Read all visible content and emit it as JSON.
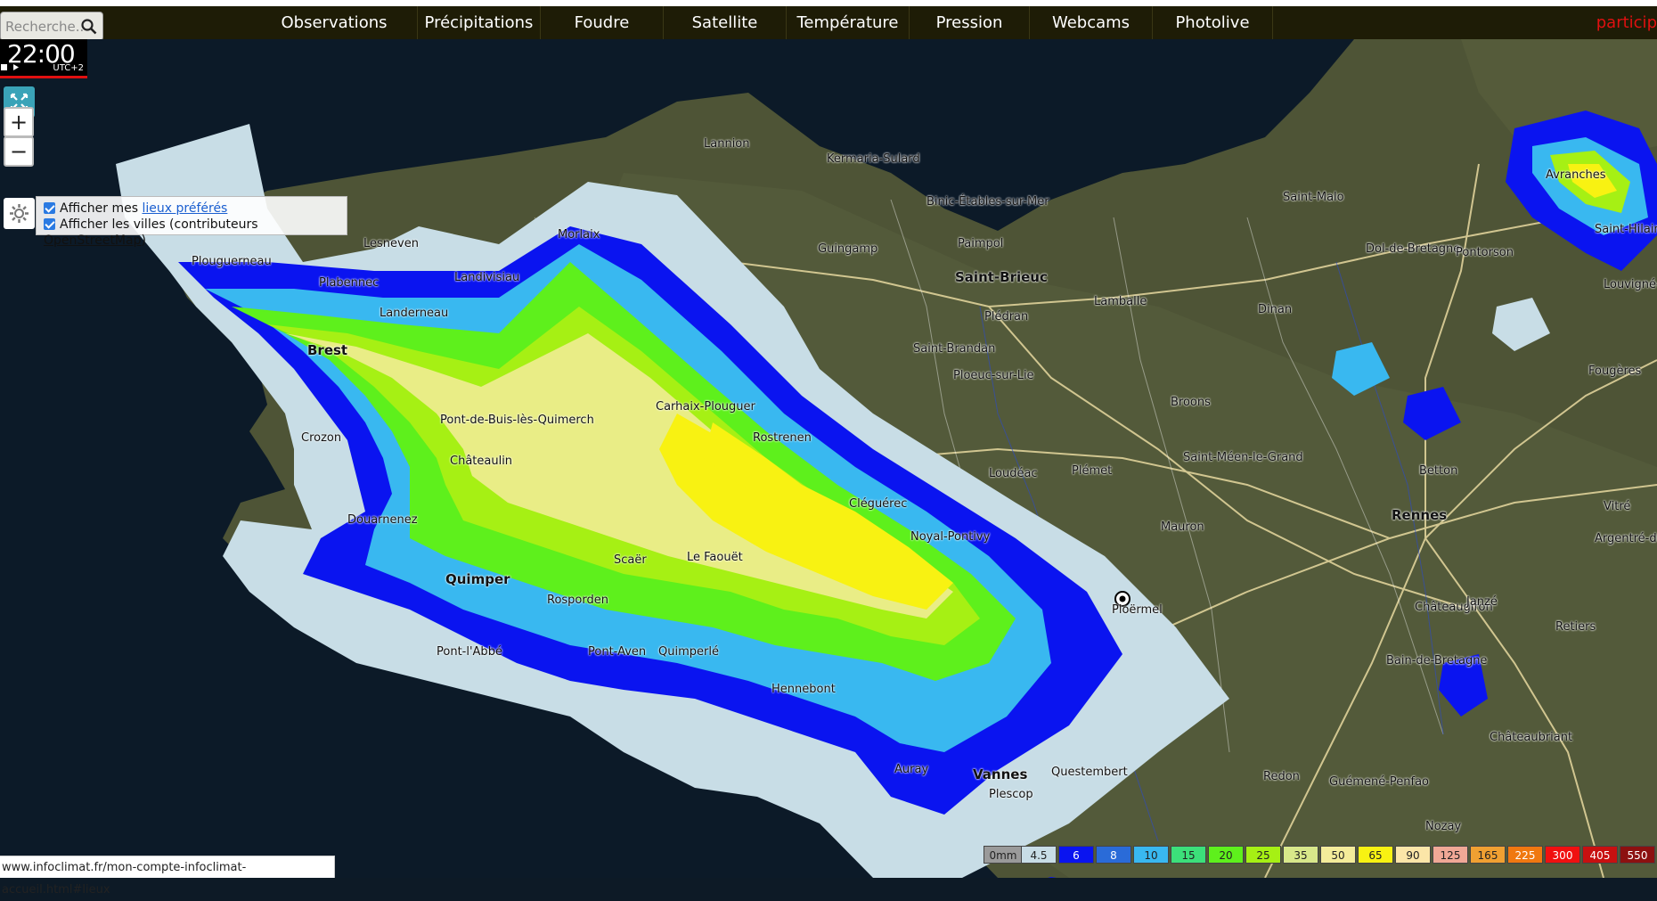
{
  "search": {
    "placeholder": "Recherche.."
  },
  "nav": {
    "items": [
      {
        "label": "Observations"
      },
      {
        "label": "Précipitations"
      },
      {
        "label": "Foudre"
      },
      {
        "label": "Satellite"
      },
      {
        "label": "Température"
      },
      {
        "label": "Pression"
      },
      {
        "label": "Webcams"
      },
      {
        "label": "Photolive"
      }
    ],
    "right_label": "particip"
  },
  "time": {
    "value": "22:00",
    "timezone": "UTC+2"
  },
  "layers": {
    "row1_prefix": "Afficher mes ",
    "row1_link": "lieux préférés",
    "row2_prefix": "Afficher les villes (contributeurs ",
    "row2_link": "OpenStreetMap",
    "row2_suffix": ")"
  },
  "status_url": "www.infoclimat.fr/mon-compte-infoclimat-accueil.html#lieux",
  "legend": [
    {
      "label": "0mm",
      "color": "#9a9a9a"
    },
    {
      "label": "4.5",
      "color": "#c8dde6"
    },
    {
      "label": "6",
      "color": "#0a14f0"
    },
    {
      "label": "8",
      "color": "#2a6bd8"
    },
    {
      "label": "10",
      "color": "#39b8f0"
    },
    {
      "label": "15",
      "color": "#3ce07a"
    },
    {
      "label": "20",
      "color": "#5ef01c"
    },
    {
      "label": "25",
      "color": "#a6f014"
    },
    {
      "label": "35",
      "color": "#d8e88a"
    },
    {
      "label": "50",
      "color": "#f4ec9a"
    },
    {
      "label": "65",
      "color": "#f8f212"
    },
    {
      "label": "90",
      "color": "#fbe6a8"
    },
    {
      "label": "125",
      "color": "#f0a896"
    },
    {
      "label": "165",
      "color": "#f0a032"
    },
    {
      "label": "225",
      "color": "#f07810"
    },
    {
      "label": "300",
      "color": "#f01010"
    },
    {
      "label": "405",
      "color": "#c81010"
    },
    {
      "label": "550",
      "color": "#8c1010"
    }
  ],
  "cities": [
    {
      "name": "Brest",
      "big": true
    },
    {
      "name": "Plouguerneau"
    },
    {
      "name": "Plabennec"
    },
    {
      "name": "Lesneven"
    },
    {
      "name": "Landerneau"
    },
    {
      "name": "Landivisiau"
    },
    {
      "name": "Morlaix"
    },
    {
      "name": "Lannion"
    },
    {
      "name": "Guingamp"
    },
    {
      "name": "Saint-Brieuc",
      "big": true
    },
    {
      "name": "Lamballe"
    },
    {
      "name": "Plédran"
    },
    {
      "name": "Saint-Brandan"
    },
    {
      "name": "Ploeuc-sur-Lie"
    },
    {
      "name": "Carhaix-Plouguer"
    },
    {
      "name": "Rostrenen"
    },
    {
      "name": "Crozon"
    },
    {
      "name": "Pont-de-Buis-lès-Quimerch"
    },
    {
      "name": "Châteaulin"
    },
    {
      "name": "Douarnenez"
    },
    {
      "name": "Quimper",
      "big": true
    },
    {
      "name": "Rosporden"
    },
    {
      "name": "Scaër"
    },
    {
      "name": "Le Faouët"
    },
    {
      "name": "Quimperlé"
    },
    {
      "name": "Hennebont"
    },
    {
      "name": "Cléguérec"
    },
    {
      "name": "Noyal-Pontivy"
    },
    {
      "name": "Loudéac"
    },
    {
      "name": "Plémet"
    },
    {
      "name": "Ploërmel"
    },
    {
      "name": "Broons"
    },
    {
      "name": "Saint-Méen-le-Grand"
    },
    {
      "name": "Mauron"
    },
    {
      "name": "Rennes",
      "big": true
    },
    {
      "name": "Dinan"
    },
    {
      "name": "Dol-de-Bretagne"
    },
    {
      "name": "Pontorson"
    },
    {
      "name": "Fougères"
    },
    {
      "name": "Betton"
    },
    {
      "name": "Châteaugiron"
    },
    {
      "name": "Vannes",
      "big": true
    },
    {
      "name": "Auray"
    },
    {
      "name": "Questembert"
    },
    {
      "name": "Redon"
    },
    {
      "name": "Guémené-Penfao"
    },
    {
      "name": "Bain-de-Bretagne"
    },
    {
      "name": "Janzé"
    },
    {
      "name": "Retiers"
    },
    {
      "name": "Châteaubriant"
    },
    {
      "name": "Nozay"
    },
    {
      "name": "Argentré-du-Plessis"
    },
    {
      "name": "Vitré"
    },
    {
      "name": "Saint-Hilaire-du-Harcouët"
    },
    {
      "name": "Louvigné-du-Désert"
    },
    {
      "name": "Avranches"
    },
    {
      "name": "Saint-Malo"
    },
    {
      "name": "Binic-Étables-sur-Mer"
    },
    {
      "name": "Paimpol"
    },
    {
      "name": "Kermaria-Sulard"
    },
    {
      "name": "Pont-Aven"
    },
    {
      "name": "Pont-l'Abbé"
    },
    {
      "name": "Plescop"
    }
  ]
}
